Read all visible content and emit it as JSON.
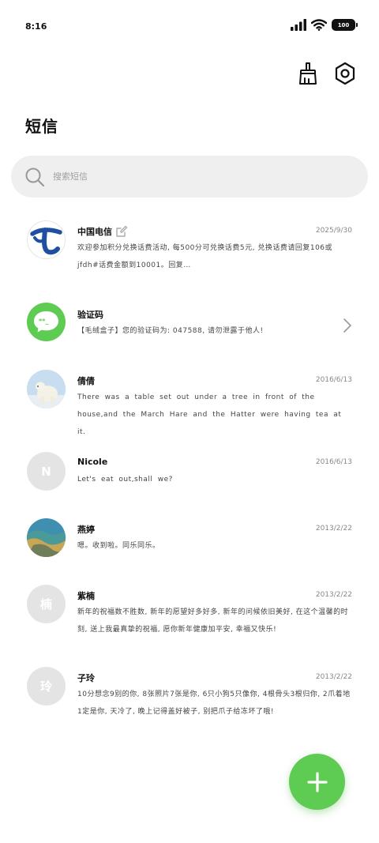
{
  "status_bar": {
    "time": "8:16",
    "battery": "100"
  },
  "header": {
    "title": "短信"
  },
  "search": {
    "placeholder": "搜索短信"
  },
  "messages": [
    {
      "name": "中国电信",
      "date": "2025/9/30",
      "body": "欢迎参加积分兑换话费活动, 每500分可兑换话费5元, 兑换话费请回复106或jfdh#话费金额到10001。回复…"
    },
    {
      "name": "验证码",
      "date": "",
      "body": "【毛绒盒子】您的验证码为: 047588, 请勿泄露于他人!"
    },
    {
      "name": "倩倩",
      "date": "2016/6/13",
      "body": "There was a table set out under a tree in front of the house,and the March Hare and the Hatter were having tea at it."
    },
    {
      "name": "Nicole",
      "avatar_letter": "N",
      "date": "2016/6/13",
      "body": "Let's eat out,shall we?"
    },
    {
      "name": "燕婷",
      "date": "2013/2/22",
      "body": "嗯。收到啦。同乐同乐。"
    },
    {
      "name": "紫楠",
      "avatar_letter": "楠",
      "date": "2013/2/22",
      "body": "新年的祝福数不胜数, 新年的愿望好多好多, 新年的问候依旧美好, 在这个温馨的时刻, 送上我最真挚的祝福, 愿你新年健康加平安, 幸福又快乐!"
    },
    {
      "name": "子玲",
      "avatar_letter": "玲",
      "date": "2013/2/22",
      "body": "10分想念9别的你, 8张照片7张是你, 6只小狗5只像你, 4根骨头3根归你, 2爪着地1定是你, 天冷了, 晚上记得盖好被子, 别把爪子给冻坏了哦!"
    }
  ],
  "colors": {
    "accent_green": "#5ecb53",
    "telecom_blue": "#1f4fa0",
    "search_bg": "#efefef"
  }
}
